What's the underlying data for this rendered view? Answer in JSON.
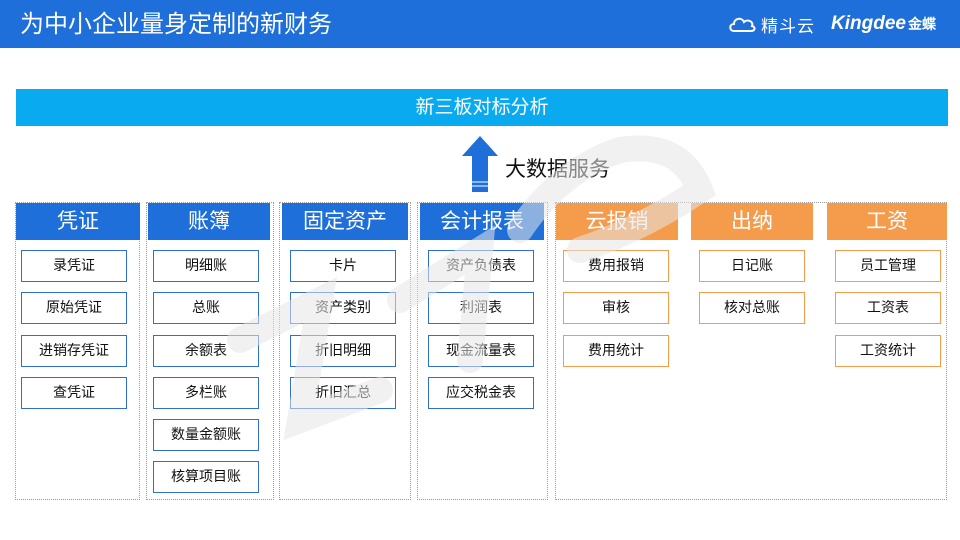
{
  "header": {
    "title": "为中小企业量身定制的新财务",
    "brand_cn": "精斗云",
    "brand_en": "Kingdee",
    "brand_en_cn": "金蝶",
    "bg_color": "#1e6fd9"
  },
  "banner": {
    "label": "新三板对标分析",
    "color": "#0aaaf0"
  },
  "arrow": {
    "label": "大数据服务",
    "icon": "arrow-up-icon"
  },
  "columns": [
    {
      "title": "凭证",
      "items": [
        "录凭证",
        "原始凭证",
        "进销存凭证",
        "查凭证"
      ]
    },
    {
      "title": "账簿",
      "items": [
        "明细账",
        "总账",
        "余额表",
        "多栏账",
        "数量金额账",
        "核算项目账"
      ]
    },
    {
      "title": "固定资产",
      "items": [
        "卡片",
        "资产类别",
        "折旧明细",
        "折旧汇总"
      ]
    },
    {
      "title": "会计报表",
      "items": [
        "资产负债表",
        "利润表",
        "现金流量表",
        "应交税金表"
      ]
    },
    {
      "title": "云报销",
      "items": [
        "费用报销",
        "审核",
        "费用统计"
      ]
    },
    {
      "title": "出纳",
      "items": [
        "日记账",
        "核对总账"
      ]
    },
    {
      "title": "工资",
      "items": [
        "员工管理",
        "工资表",
        "工资统计"
      ]
    }
  ],
  "colors": {
    "blue": "#1e6fd9",
    "orange": "#f59b4c",
    "watermark": "#e9e9e9"
  }
}
